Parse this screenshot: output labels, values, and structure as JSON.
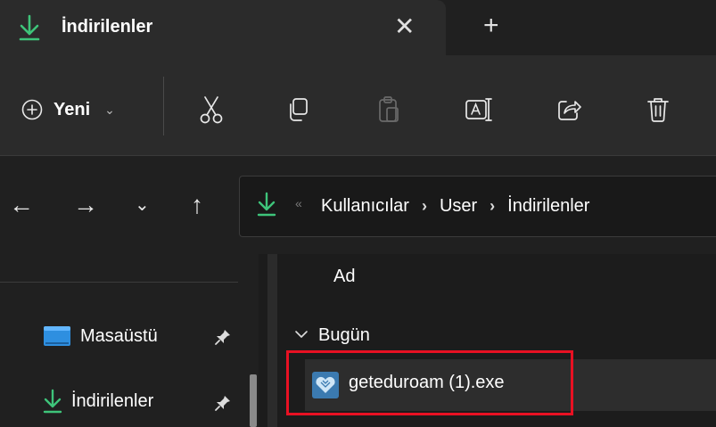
{
  "tab": {
    "title": "İndirilenler",
    "close_glyph": "✕",
    "new_tab_glyph": "+"
  },
  "toolbar": {
    "new_label": "Yeni",
    "new_chevron": "⌄",
    "icons": [
      "plus-circle-icon",
      "cut-icon",
      "copy-icon",
      "paste-icon",
      "rename-icon",
      "share-icon",
      "delete-icon"
    ]
  },
  "nav": {
    "back": "←",
    "forward": "→",
    "recent": "⌄",
    "up": "↑"
  },
  "address": {
    "overflow": "«",
    "crumbs": [
      "Kullanıcılar",
      "User",
      "İndirilenler"
    ],
    "separator": "›"
  },
  "sidebar": {
    "items": [
      {
        "label": "Masaüstü",
        "icon": "desktop-folder-icon",
        "pinned": true
      },
      {
        "label": "İndirilenler",
        "icon": "download-icon",
        "pinned": true
      }
    ]
  },
  "filelist": {
    "column_name": "Ad",
    "group_label": "Bugün",
    "files": [
      {
        "name": "geteduroam (1).exe",
        "icon": "geteduroam-app-icon"
      }
    ]
  },
  "colors": {
    "accent_green": "#3ec47a",
    "highlight_red": "#e81123",
    "folder_blue": "#2e8fe0"
  }
}
